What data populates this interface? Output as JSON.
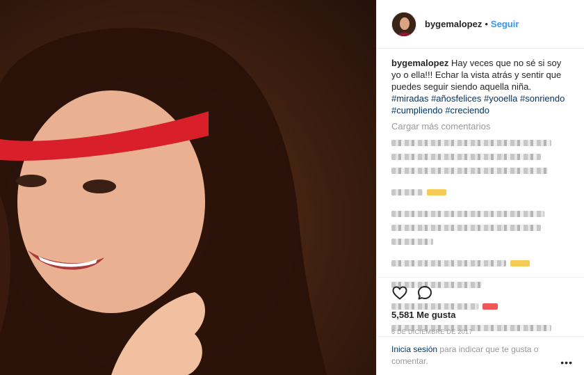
{
  "header": {
    "username": "bygemalopez",
    "separator": "•",
    "follow_label": "Seguir"
  },
  "caption": {
    "username": "bygemalopez",
    "text": "Hay veces que no sé si soy yo o ella!!! Echar la vista atrás y sentir que puedes seguir siendo aquella niña.",
    "hashtags": [
      "#miradas",
      "#añosfelices",
      "#yooella",
      "#sonriendo",
      "#cumpliendo",
      "#creciendo"
    ]
  },
  "load_more_label": "Cargar más comentarios",
  "actions": {
    "likes": "5,581 Me gusta",
    "date": "6 DE DICIEMBRE DE 2017"
  },
  "footer": {
    "login_label": "Inicia sesión",
    "rest_text": " para indicar que te gusta o comentar.",
    "more_label": "•••"
  },
  "icons": {
    "like": "heart-outline-icon",
    "comment": "comment-bubble-icon"
  }
}
